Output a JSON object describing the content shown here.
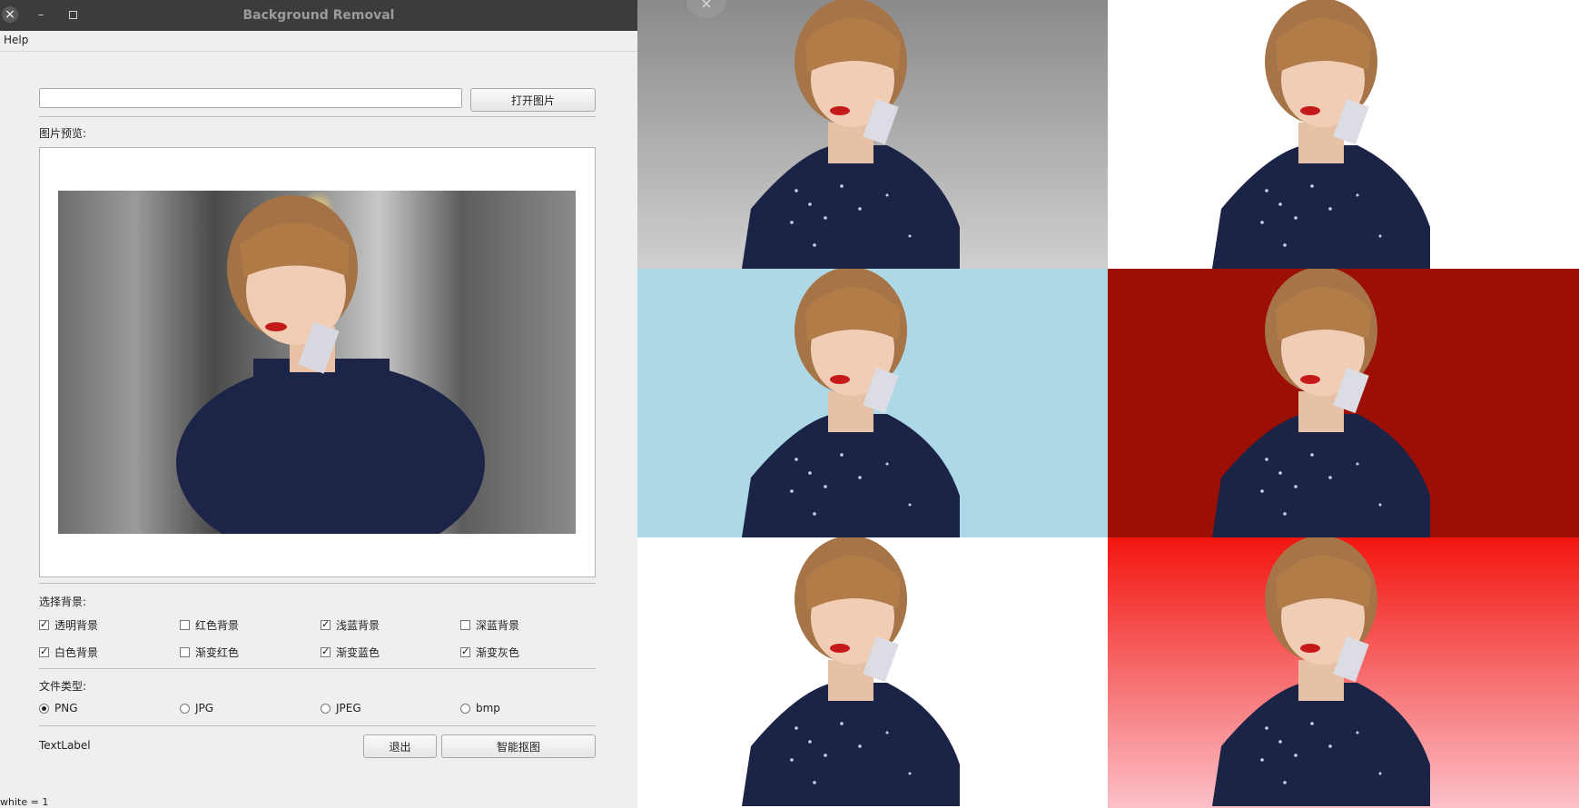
{
  "window": {
    "title": "Background Removal",
    "buttons": {
      "close_icon": "×",
      "minimize_icon": "–"
    }
  },
  "menu": {
    "help": "Help"
  },
  "toolbar": {
    "open_image": "打开图片"
  },
  "preview": {
    "label": "图片预览:"
  },
  "background": {
    "label": "选择背景:",
    "options": [
      {
        "label": "透明背景",
        "checked": true
      },
      {
        "label": "红色背景",
        "checked": false
      },
      {
        "label": "浅蓝背景",
        "checked": true
      },
      {
        "label": "深蓝背景",
        "checked": false
      },
      {
        "label": "白色背景",
        "checked": true
      },
      {
        "label": "渐变红色",
        "checked": false
      },
      {
        "label": "渐变蓝色",
        "checked": true
      },
      {
        "label": "渐变灰色",
        "checked": true
      }
    ]
  },
  "filetype": {
    "label": "文件类型:",
    "options": [
      {
        "label": "PNG",
        "selected": true
      },
      {
        "label": "JPG",
        "selected": false
      },
      {
        "label": "JPEG",
        "selected": false
      },
      {
        "label": "bmp",
        "selected": false
      }
    ]
  },
  "footer": {
    "text_label": "TextLabel",
    "quit": "退出",
    "cutout": "智能抠图"
  },
  "status": {
    "text": "white  = 1"
  },
  "results": {
    "backgrounds": [
      {
        "name": "gradient-gray",
        "color_top": "#8a8a8a",
        "color_bottom": "#cfcfcf"
      },
      {
        "name": "white",
        "color": "#ffffff"
      },
      {
        "name": "light-blue",
        "color": "#add8e6"
      },
      {
        "name": "dark-red",
        "color": "#9b0f05"
      },
      {
        "name": "white-2",
        "color": "#ffffff"
      },
      {
        "name": "gradient-red",
        "color_top": "#f3150f",
        "color_bottom": "#fbc0c8"
      }
    ]
  }
}
